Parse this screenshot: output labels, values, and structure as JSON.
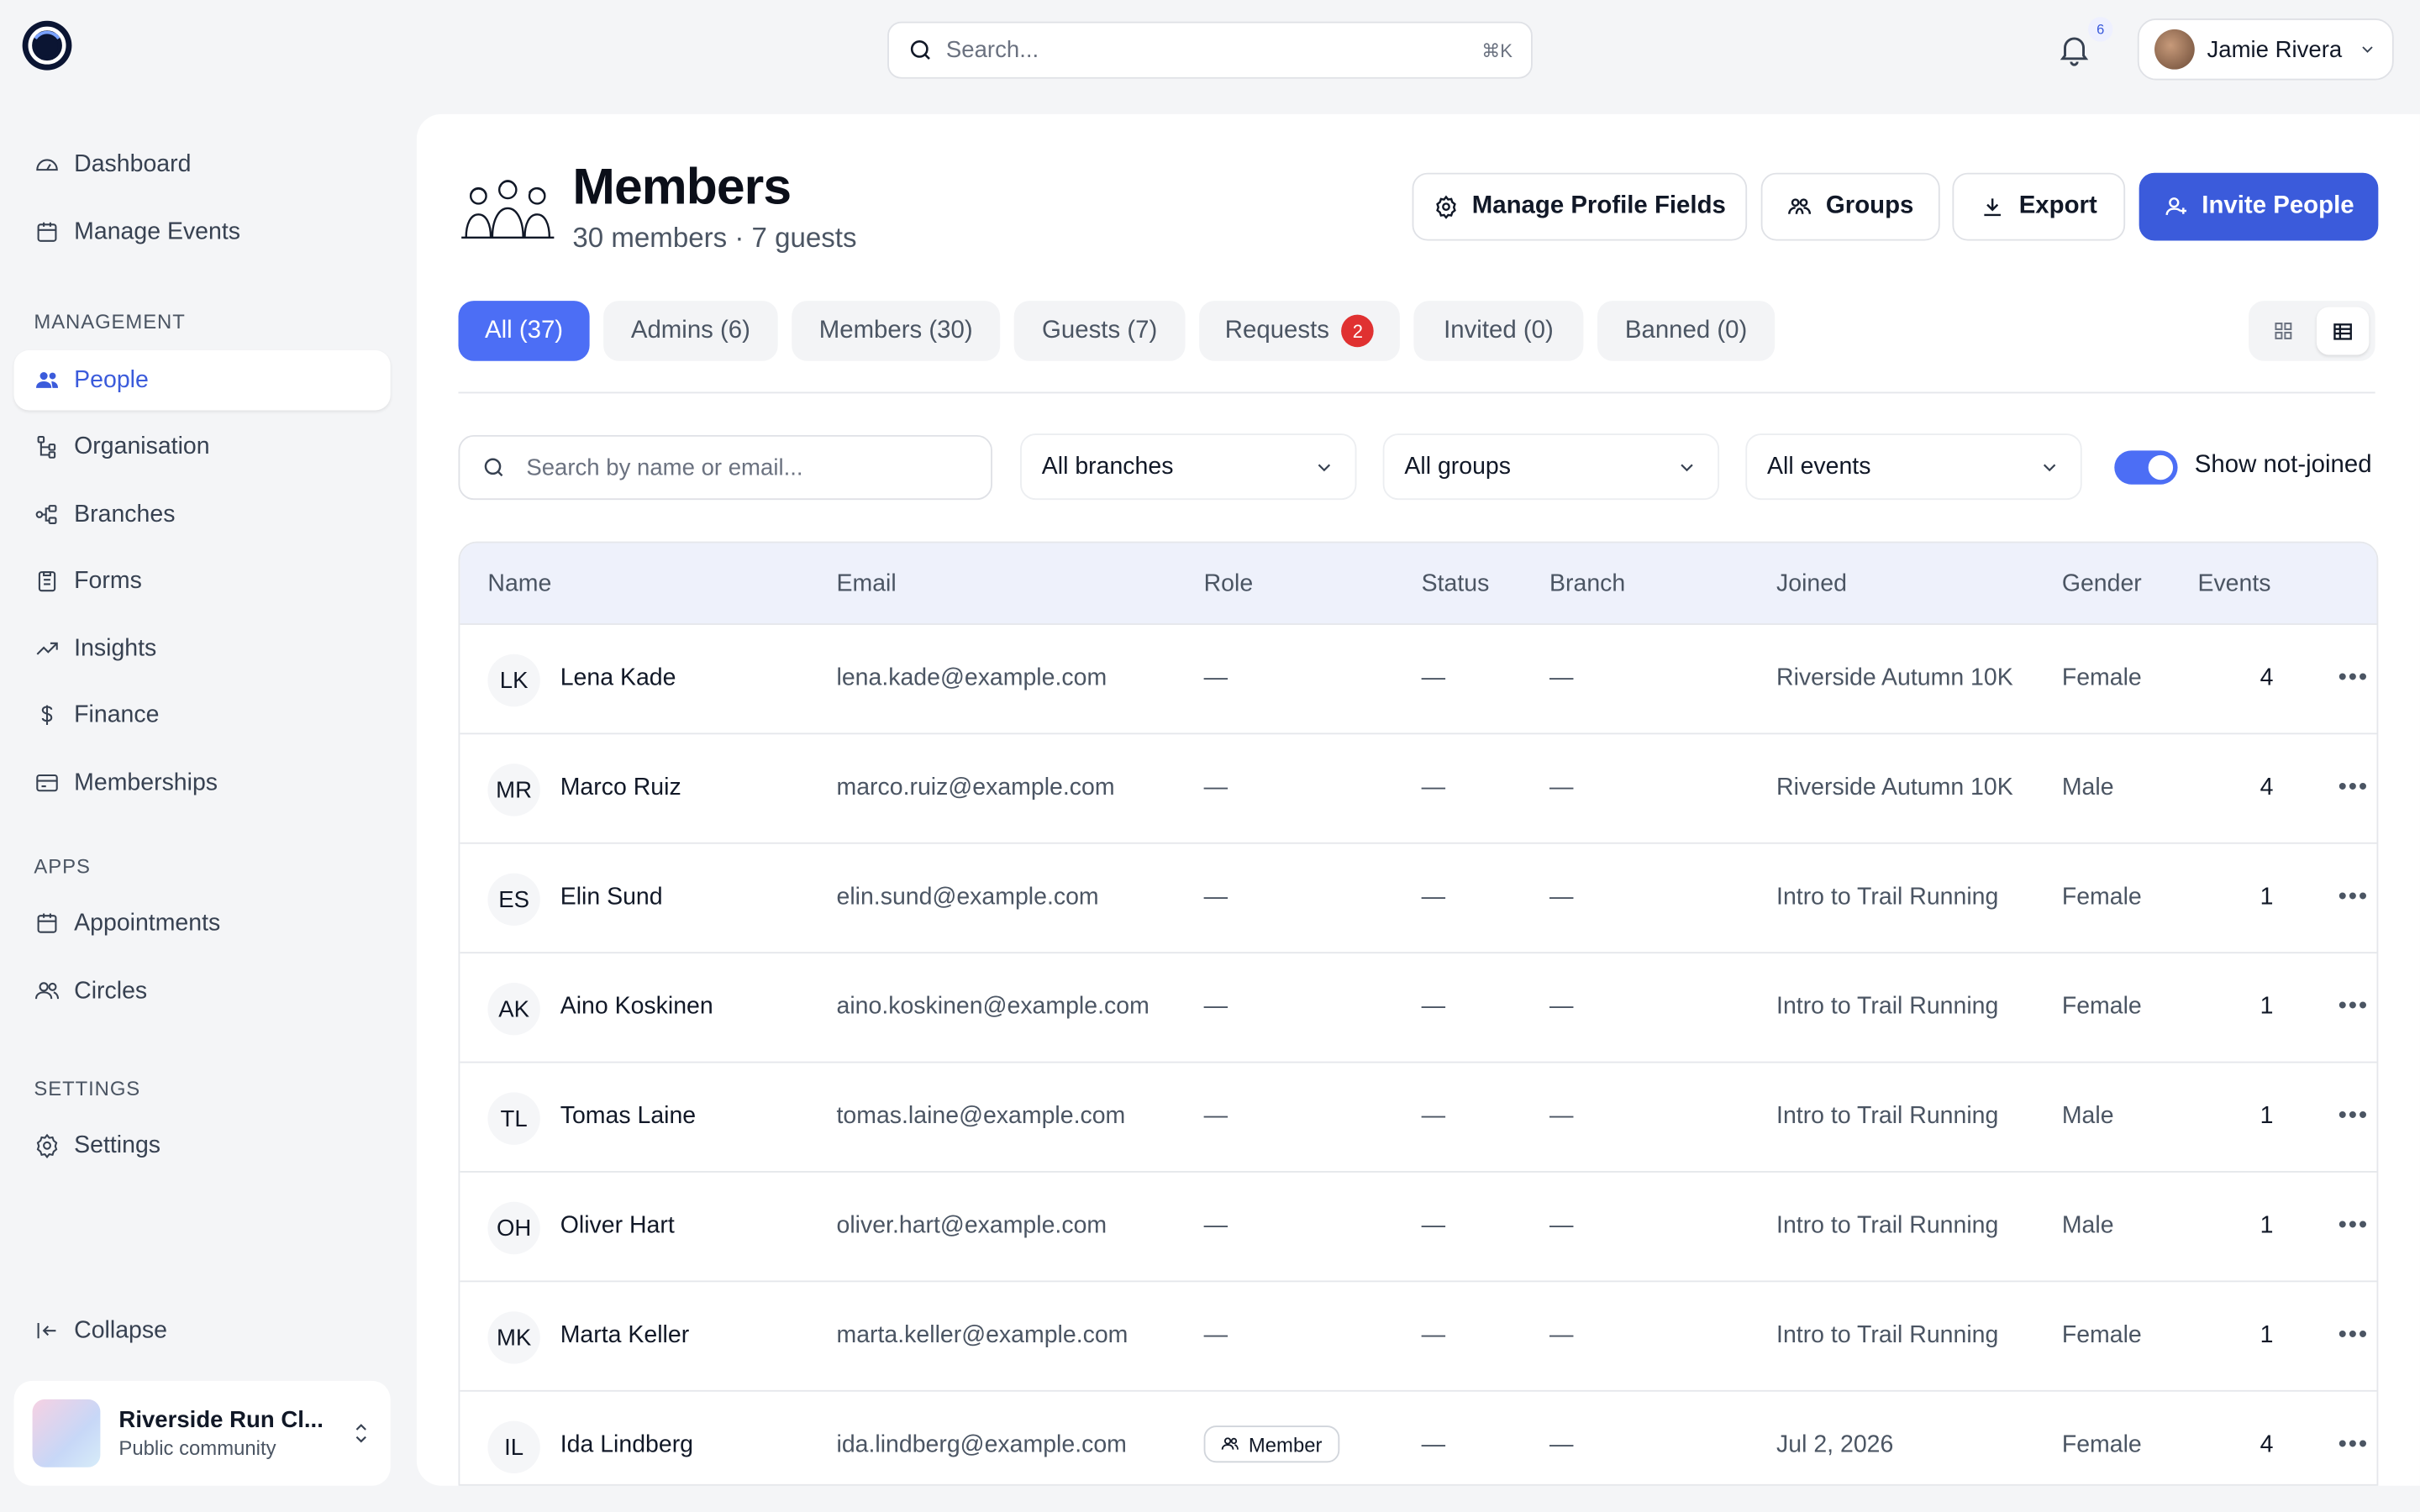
{
  "topbar": {
    "search_placeholder": "Search...",
    "search_shortcut": "⌘K",
    "notification_count": "6",
    "user_name": "Jamie Rivera"
  },
  "sidebar": {
    "top_items": [
      {
        "label": "Dashboard",
        "icon": "gauge-icon"
      },
      {
        "label": "Manage Events",
        "icon": "calendar-icon"
      }
    ],
    "management_heading": "MANAGEMENT",
    "management_items": [
      {
        "label": "People",
        "icon": "users-icon",
        "active": true
      },
      {
        "label": "Organisation",
        "icon": "hierarchy-icon"
      },
      {
        "label": "Branches",
        "icon": "branches-icon"
      },
      {
        "label": "Forms",
        "icon": "clipboard-icon"
      },
      {
        "label": "Insights",
        "icon": "trend-icon"
      },
      {
        "label": "Finance",
        "icon": "dollar-icon"
      },
      {
        "label": "Memberships",
        "icon": "card-icon"
      }
    ],
    "apps_heading": "APPS",
    "apps_items": [
      {
        "label": "Appointments",
        "icon": "calendar-icon"
      },
      {
        "label": "Circles",
        "icon": "users-icon"
      }
    ],
    "settings_heading": "SETTINGS",
    "settings_items": [
      {
        "label": "Settings",
        "icon": "gear-icon"
      }
    ],
    "collapse_label": "Collapse",
    "org": {
      "name": "Riverside Run Cl...",
      "subtitle": "Public community"
    }
  },
  "header": {
    "title": "Members",
    "subtitle": "30 members · 7 guests",
    "buttons": {
      "manage_fields": "Manage Profile Fields",
      "groups": "Groups",
      "export": "Export",
      "invite": "Invite People"
    }
  },
  "tabs": [
    {
      "label": "All (37)",
      "active": true
    },
    {
      "label": "Admins (6)"
    },
    {
      "label": "Members (30)"
    },
    {
      "label": "Guests (7)"
    },
    {
      "label": "Requests",
      "badge": "2"
    },
    {
      "label": "Invited (0)"
    },
    {
      "label": "Banned (0)"
    }
  ],
  "filters": {
    "search_placeholder": "Search by name or email...",
    "branches": "All branches",
    "groups": "All groups",
    "events": "All events",
    "toggle_label": "Show not-joined",
    "toggle_on": true
  },
  "table": {
    "columns": [
      "Name",
      "Email",
      "Role",
      "Status",
      "Branch",
      "Joined",
      "Gender",
      "Events"
    ],
    "rows": [
      {
        "initials": "LK",
        "name": "Lena Kade",
        "email": "lena.kade@example.com",
        "role": "—",
        "status": "—",
        "branch": "—",
        "joined": "Riverside Autumn 10K",
        "gender": "Female",
        "events": "4"
      },
      {
        "initials": "MR",
        "name": "Marco Ruiz",
        "email": "marco.ruiz@example.com",
        "role": "—",
        "status": "—",
        "branch": "—",
        "joined": "Riverside Autumn 10K",
        "gender": "Male",
        "events": "4"
      },
      {
        "initials": "ES",
        "name": "Elin Sund",
        "email": "elin.sund@example.com",
        "role": "—",
        "status": "—",
        "branch": "—",
        "joined": "Intro to Trail Running",
        "gender": "Female",
        "events": "1"
      },
      {
        "initials": "AK",
        "name": "Aino Koskinen",
        "email": "aino.koskinen@example.com",
        "role": "—",
        "status": "—",
        "branch": "—",
        "joined": "Intro to Trail Running",
        "gender": "Female",
        "events": "1"
      },
      {
        "initials": "TL",
        "name": "Tomas Laine",
        "email": "tomas.laine@example.com",
        "role": "—",
        "status": "—",
        "branch": "—",
        "joined": "Intro to Trail Running",
        "gender": "Male",
        "events": "1"
      },
      {
        "initials": "OH",
        "name": "Oliver Hart",
        "email": "oliver.hart@example.com",
        "role": "—",
        "status": "—",
        "branch": "—",
        "joined": "Intro to Trail Running",
        "gender": "Male",
        "events": "1"
      },
      {
        "initials": "MK",
        "name": "Marta Keller",
        "email": "marta.keller@example.com",
        "role": "—",
        "status": "—",
        "branch": "—",
        "joined": "Intro to Trail Running",
        "gender": "Female",
        "events": "1"
      },
      {
        "initials": "IL",
        "name": "Ida Lindberg",
        "email": "ida.lindberg@example.com",
        "role": "Member",
        "role_chip": true,
        "status": "—",
        "branch": "—",
        "joined": "Jul 2, 2026",
        "gender": "Female",
        "events": "4"
      }
    ]
  },
  "colors": {
    "accent": "#3b5bdb",
    "accent_light": "#4c6ef5",
    "badge_red": "#e03131",
    "header_bg": "#eef1fb"
  }
}
